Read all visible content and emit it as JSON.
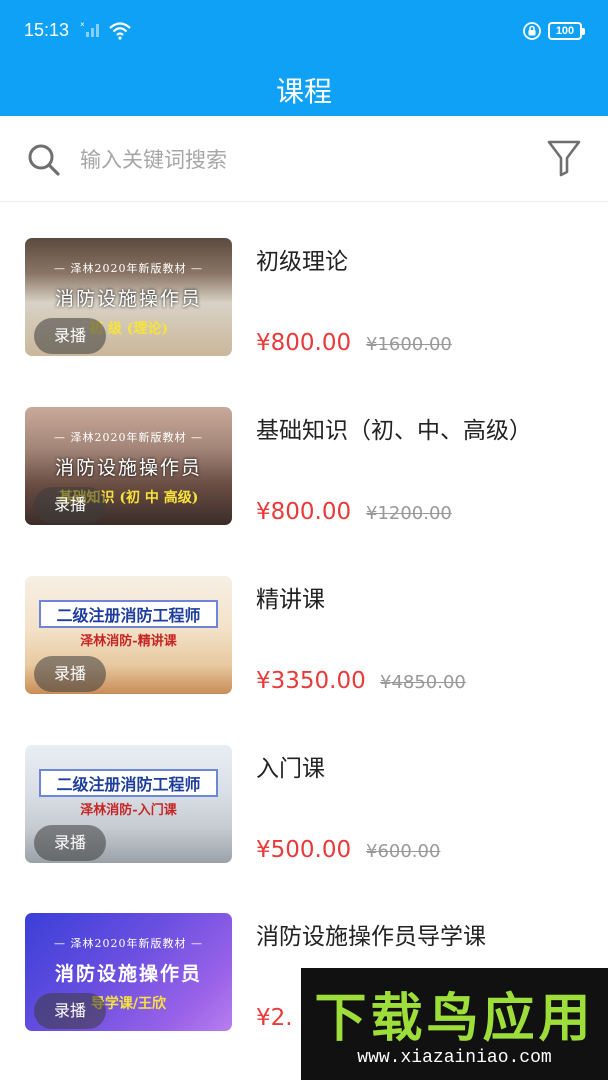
{
  "status": {
    "time": "15:13",
    "battery": "100"
  },
  "header": {
    "title": "课程"
  },
  "search": {
    "placeholder": "输入关键词搜索"
  },
  "courses": [
    {
      "title": "初级理论",
      "badge": "录播",
      "price": "¥800.00",
      "original_price": "¥1600.00",
      "thumb": {
        "line1": "— 泽林2020年新版教材 —",
        "line2": "消防设施操作员",
        "line3": "初 级 (理论)"
      }
    },
    {
      "title": "基础知识（初、中、高级）",
      "badge": "录播",
      "price": "¥800.00",
      "original_price": "¥1200.00",
      "thumb": {
        "line1": "— 泽林2020年新版教材 —",
        "line2": "消防设施操作员",
        "line3": "基础知识 (初 中 高级)"
      }
    },
    {
      "title": "精讲课",
      "badge": "录播",
      "price": "¥3350.00",
      "original_price": "¥4850.00",
      "thumb": {
        "line1": "",
        "line2": "二级注册消防工程师",
        "line3": "泽林消防-精讲课"
      }
    },
    {
      "title": "入门课",
      "badge": "录播",
      "price": "¥500.00",
      "original_price": "¥600.00",
      "thumb": {
        "line1": "",
        "line2": "二级注册消防工程师",
        "line3": "泽林消防-入门课"
      }
    },
    {
      "title": "消防设施操作员导学课",
      "badge": "录播",
      "price": "¥2.",
      "original_price": "",
      "thumb": {
        "line1": "— 泽林2020年新版教材 —",
        "line2": "消防设施操作员",
        "line3": "导学课/王欣"
      }
    }
  ],
  "watermark": {
    "text": "下载鸟应用",
    "url": "www.xiazainiao.com"
  },
  "colors": {
    "primary": "#0fa1f6",
    "price": "#e83a3a",
    "watermark_green": "#9ede3b"
  }
}
